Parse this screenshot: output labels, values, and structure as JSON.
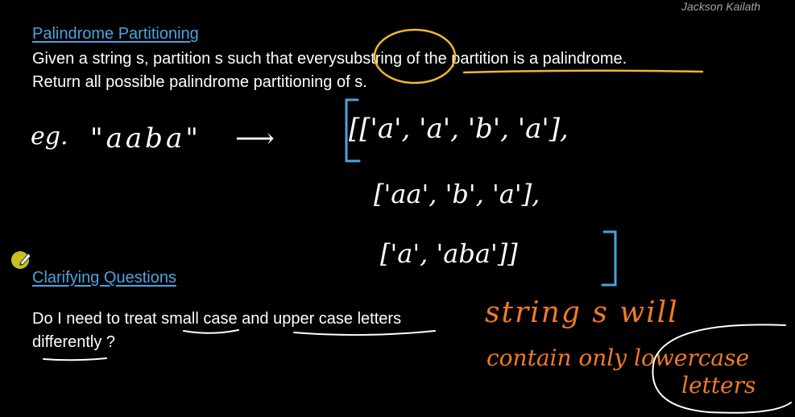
{
  "author": "Jackson Kailath",
  "problem": {
    "heading": "Palindrome Partitioning",
    "line1_pre": "Given a string s, partition s such that every",
    "line1_circled": "substring",
    "line1_post": "of the partition is a palindrome.",
    "line2": "Return all possible palindrome partitioning of s."
  },
  "example": {
    "label": "eg.",
    "input": "\"aaba\"",
    "arrow": "⟶",
    "row1": "[['a', 'a', 'b', 'a'],",
    "row2": "['aa', 'b', 'a'],",
    "row3": "['a', 'aba']]"
  },
  "clarifying": {
    "heading": "Clarifying Questions",
    "q_pre": "Do I need to treat",
    "q_u1": "small case",
    "q_mid": "and",
    "q_u2": "upper case letters",
    "q_line2": "differently ?"
  },
  "answer": {
    "line1": "string s will",
    "line2_pre": "contain only",
    "line2_circled": "lowercase",
    "line3": "letters"
  },
  "colors": {
    "background": "#000000",
    "text": "#ffffff",
    "heading": "#4aa3df",
    "orange_ink": "#f07a28",
    "yellow_ink": "#f2b632",
    "blue_ink": "#4aa3df",
    "cursor": "#c8c020"
  },
  "icons": {
    "cursor": "pen-cursor-icon"
  }
}
